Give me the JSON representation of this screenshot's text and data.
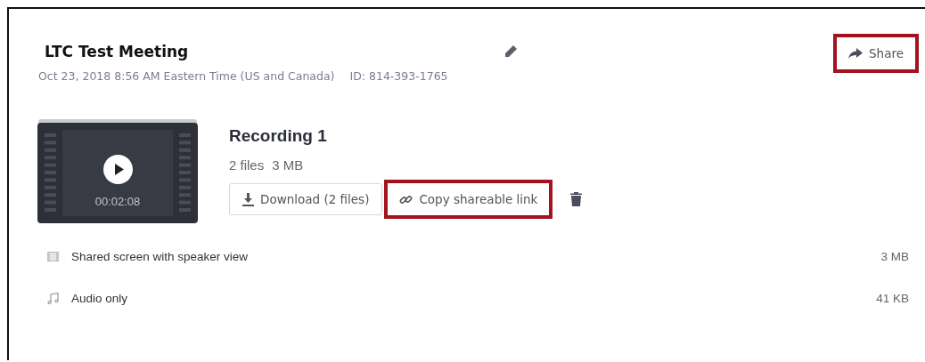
{
  "meeting": {
    "title": "LTC Test Meeting",
    "date": "Oct 23, 2018 8:56 AM Eastern Time (US and Canada)",
    "id": "ID: 814-393-1765"
  },
  "share_button": {
    "label": "Share",
    "highlighted": true
  },
  "recording": {
    "title": "Recording 1",
    "file_count": "2 files",
    "size": "3 MB",
    "duration": "00:02:08",
    "buttons": [
      {
        "kind": "download",
        "label": "Download (2 files)",
        "highlighted": false
      },
      {
        "kind": "link",
        "label": "Copy shareable link",
        "highlighted": true
      }
    ]
  },
  "files": [
    {
      "kind": "video",
      "name": "Shared screen with speaker view",
      "size": "3 MB"
    },
    {
      "kind": "audio",
      "name": "Audio only",
      "size": "41 KB"
    }
  ]
}
